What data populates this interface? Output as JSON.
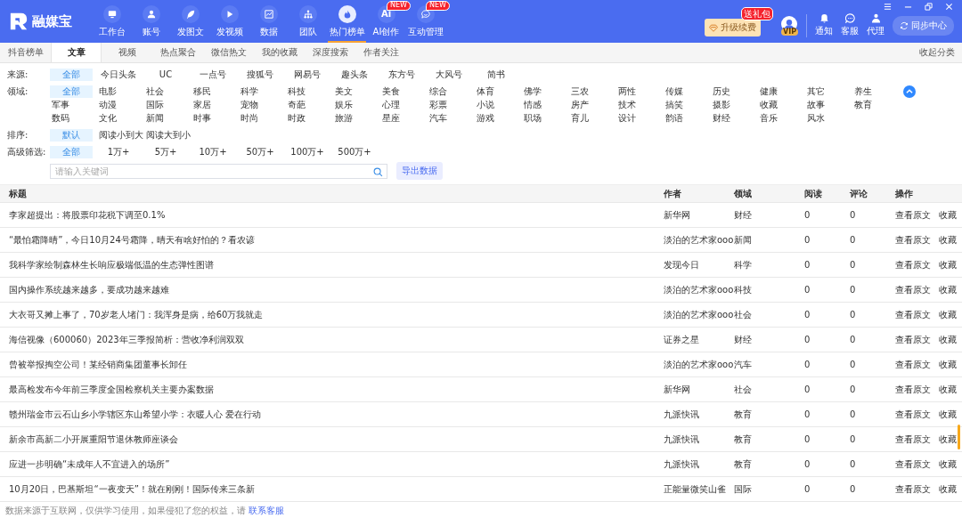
{
  "app": {
    "name": "融媒宝"
  },
  "nav": [
    {
      "label": "工作台",
      "selected": false
    },
    {
      "label": "账号",
      "selected": false
    },
    {
      "label": "发图文",
      "selected": false
    },
    {
      "label": "发视频",
      "selected": false
    },
    {
      "label": "数据",
      "selected": false
    },
    {
      "label": "团队",
      "selected": false
    },
    {
      "label": "热门榜单",
      "selected": true
    },
    {
      "label": "AI创作",
      "selected": false,
      "icon_text": "Ai",
      "badge": "NEW"
    },
    {
      "label": "互动管理",
      "selected": false,
      "badge": "NEW"
    }
  ],
  "upgrade": {
    "label": "升级续费",
    "badge": "送礼包"
  },
  "avatar": {
    "badge": "VIP"
  },
  "tools": [
    {
      "label": "通知"
    },
    {
      "label": "客服"
    },
    {
      "label": "代理"
    }
  ],
  "sync_button": "同步中心",
  "tabs": [
    {
      "label": "抖音榜单",
      "selected": false
    },
    {
      "label": "文章",
      "selected": true
    },
    {
      "label": "视频",
      "selected": false
    },
    {
      "label": "热点聚合",
      "selected": false
    },
    {
      "label": "微信热文",
      "selected": false
    },
    {
      "label": "我的收藏",
      "selected": false
    },
    {
      "label": "深度搜索",
      "selected": false
    },
    {
      "label": "作者关注",
      "selected": false
    }
  ],
  "collapse_link": "收起分类",
  "filters": [
    {
      "label": "来源:",
      "options": [
        {
          "label": "全部",
          "selected": true
        },
        {
          "label": "今日头条",
          "selected": false
        },
        {
          "label": "UC",
          "selected": false
        },
        {
          "label": "一点号",
          "selected": false
        },
        {
          "label": "搜狐号",
          "selected": false
        },
        {
          "label": "网易号",
          "selected": false
        },
        {
          "label": "趣头条",
          "selected": false
        },
        {
          "label": "东方号",
          "selected": false
        },
        {
          "label": "大风号",
          "selected": false
        },
        {
          "label": "简书",
          "selected": false
        }
      ]
    },
    {
      "label": "领域:",
      "expanded": true,
      "options": [
        {
          "label": "全部",
          "selected": true
        },
        {
          "label": "电影",
          "selected": false
        },
        {
          "label": "社会",
          "selected": false
        },
        {
          "label": "移民",
          "selected": false
        },
        {
          "label": "科学",
          "selected": false
        },
        {
          "label": "科技",
          "selected": false
        },
        {
          "label": "美文",
          "selected": false
        },
        {
          "label": "美食",
          "selected": false
        },
        {
          "label": "综合",
          "selected": false
        },
        {
          "label": "体育",
          "selected": false
        },
        {
          "label": "佛学",
          "selected": false
        },
        {
          "label": "三农",
          "selected": false
        },
        {
          "label": "两性",
          "selected": false
        },
        {
          "label": "传媒",
          "selected": false
        },
        {
          "label": "历史",
          "selected": false
        },
        {
          "label": "健康",
          "selected": false
        },
        {
          "label": "其它",
          "selected": false
        },
        {
          "label": "养生",
          "selected": false
        },
        {
          "label": "军事",
          "selected": false
        },
        {
          "label": "动漫",
          "selected": false
        },
        {
          "label": "国际",
          "selected": false
        },
        {
          "label": "家居",
          "selected": false
        },
        {
          "label": "宠物",
          "selected": false
        },
        {
          "label": "奇葩",
          "selected": false
        },
        {
          "label": "娱乐",
          "selected": false
        },
        {
          "label": "心理",
          "selected": false
        },
        {
          "label": "彩票",
          "selected": false
        },
        {
          "label": "小说",
          "selected": false
        },
        {
          "label": "情感",
          "selected": false
        },
        {
          "label": "房产",
          "selected": false
        },
        {
          "label": "技术",
          "selected": false
        },
        {
          "label": "搞笑",
          "selected": false
        },
        {
          "label": "摄影",
          "selected": false
        },
        {
          "label": "收藏",
          "selected": false
        },
        {
          "label": "故事",
          "selected": false
        },
        {
          "label": "教育",
          "selected": false
        },
        {
          "label": "数码",
          "selected": false
        },
        {
          "label": "文化",
          "selected": false
        },
        {
          "label": "新闻",
          "selected": false
        },
        {
          "label": "时事",
          "selected": false
        },
        {
          "label": "时尚",
          "selected": false
        },
        {
          "label": "时政",
          "selected": false
        },
        {
          "label": "旅游",
          "selected": false
        },
        {
          "label": "星座",
          "selected": false
        },
        {
          "label": "汽车",
          "selected": false
        },
        {
          "label": "游戏",
          "selected": false
        },
        {
          "label": "职场",
          "selected": false
        },
        {
          "label": "育儿",
          "selected": false
        },
        {
          "label": "设计",
          "selected": false
        },
        {
          "label": "韵语",
          "selected": false
        },
        {
          "label": "财经",
          "selected": false
        },
        {
          "label": "音乐",
          "selected": false
        },
        {
          "label": "风水",
          "selected": false
        }
      ]
    },
    {
      "label": "排序:",
      "options": [
        {
          "label": "默认",
          "selected": true
        },
        {
          "label": "阅读小到大",
          "selected": false
        },
        {
          "label": "阅读大到小",
          "selected": false
        }
      ]
    },
    {
      "label": "高级筛选:",
      "options": [
        {
          "label": "全部",
          "selected": true
        },
        {
          "label": "1万+",
          "selected": false
        },
        {
          "label": "5万+",
          "selected": false
        },
        {
          "label": "10万+",
          "selected": false
        },
        {
          "label": "50万+",
          "selected": false
        },
        {
          "label": "100万+",
          "selected": false
        },
        {
          "label": "500万+",
          "selected": false
        }
      ]
    }
  ],
  "search": {
    "placeholder": "请输入关键词"
  },
  "export_button": "导出数据",
  "table": {
    "columns": [
      "标题",
      "作者",
      "领域",
      "阅读",
      "评论",
      "操作"
    ],
    "rows": [
      {
        "title": "李家超提出：将股票印花税下调至0.1%",
        "author": "新华网",
        "category": "财经",
        "reads": "0",
        "comments": "0",
        "actions": [
          "查看原文",
          "收藏"
        ]
      },
      {
        "title": "“最怕霜降晴”，今日10月24号霜降，晴天有啥好怕的？看农谚",
        "author": "淡泊的艺术家ooo",
        "category": "新闻",
        "reads": "0",
        "comments": "0",
        "actions": [
          "查看原文",
          "收藏"
        ]
      },
      {
        "title": "我科学家绘制森林生长响应极端低温的生态弹性图谱",
        "author": "发现今日",
        "category": "科学",
        "reads": "0",
        "comments": "0",
        "actions": [
          "查看原文",
          "收藏"
        ]
      },
      {
        "title": "国内操作系统越来越多，要成功越来越难",
        "author": "淡泊的艺术家ooo",
        "category": "科技",
        "reads": "0",
        "comments": "0",
        "actions": [
          "查看原文",
          "收藏"
        ]
      },
      {
        "title": "大衣哥又摊上事了，70岁老人堵门：我浑身是病，给60万我就走",
        "author": "淡泊的艺术家ooo",
        "category": "社会",
        "reads": "0",
        "comments": "0",
        "actions": [
          "查看原文",
          "收藏"
        ]
      },
      {
        "title": "海信视像（600060）2023年三季报简析：营收净利润双双",
        "author": "证券之星",
        "category": "财经",
        "reads": "0",
        "comments": "0",
        "actions": [
          "查看原文",
          "收藏"
        ]
      },
      {
        "title": "曾被举报掏空公司！某经销商集团董事长卸任",
        "author": "淡泊的艺术家ooo",
        "category": "汽车",
        "reads": "0",
        "comments": "0",
        "actions": [
          "查看原文",
          "收藏"
        ]
      },
      {
        "title": "最高检发布今年前三季度全国检察机关主要办案数据",
        "author": "新华网",
        "category": "社会",
        "reads": "0",
        "comments": "0",
        "actions": [
          "查看原文",
          "收藏"
        ]
      },
      {
        "title": "赣州瑞金市云石山乡小学辖区东山希望小学：衣暖人心 爱在行动",
        "author": "九派快讯",
        "category": "教育",
        "reads": "0",
        "comments": "0",
        "actions": [
          "查看原文",
          "收藏"
        ]
      },
      {
        "title": "新余市高新二小开展重阳节退休教师座谈会",
        "author": "九派快讯",
        "category": "教育",
        "reads": "0",
        "comments": "0",
        "actions": [
          "查看原文",
          "收藏"
        ]
      },
      {
        "title": "应进一步明确“未成年人不宜进入的场所”",
        "author": "九派快讯",
        "category": "教育",
        "reads": "0",
        "comments": "0",
        "actions": [
          "查看原文",
          "收藏"
        ]
      },
      {
        "title": "10月20日，巴基斯坦“一夜变天”！就在刚刚！国际传来三条新",
        "author": "正能量微笑山雀",
        "category": "国际",
        "reads": "0",
        "comments": "0",
        "actions": [
          "查看原文",
          "收藏"
        ]
      }
    ]
  },
  "footer": {
    "text": "数据来源于互联网，仅供学习使用，如果侵犯了您的权益，请",
    "link": "联系客服"
  }
}
